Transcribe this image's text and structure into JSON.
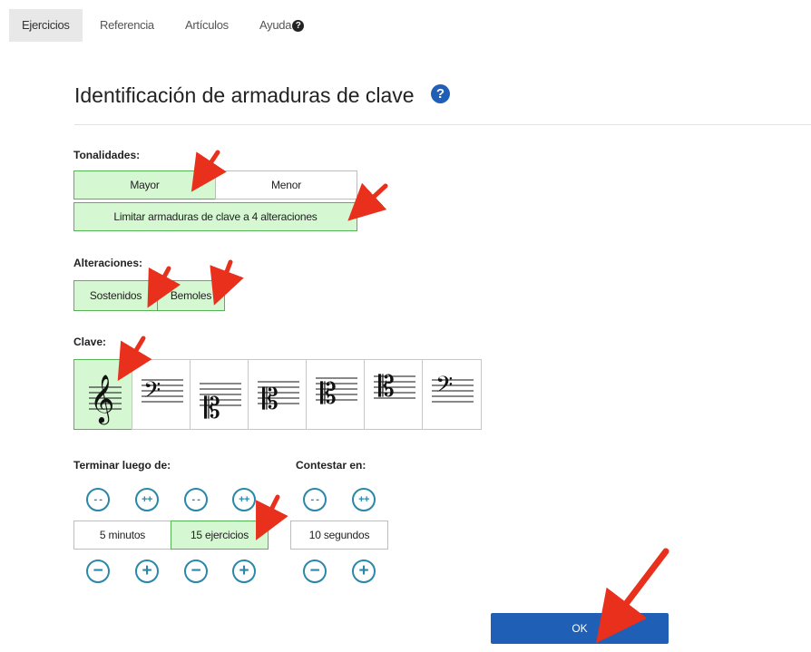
{
  "nav": {
    "tabs": [
      {
        "label": "Ejercicios",
        "active": true
      },
      {
        "label": "Referencia",
        "active": false
      },
      {
        "label": "Artículos",
        "active": false
      },
      {
        "label": "Ayuda",
        "active": false
      }
    ],
    "help_icon": "question-circle-icon"
  },
  "page": {
    "title": "Identificación de armaduras de clave",
    "help_icon": "question-circle-icon"
  },
  "tonalidades": {
    "label": "Tonalidades:",
    "mayor": "Mayor",
    "menor": "Menor",
    "limitar": "Limitar armaduras de clave a 4 alteraciones",
    "selected": [
      "Mayor",
      "Limitar armaduras de clave a 4 alteraciones"
    ]
  },
  "alteraciones": {
    "label": "Alteraciones:",
    "sostenidos": "Sostenidos",
    "bemoles": "Bemoles",
    "selected": [
      "Sostenidos",
      "Bemoles"
    ]
  },
  "clave": {
    "label": "Clave:",
    "options": [
      "treble-clef-icon",
      "bass-clef-icon",
      "alto-clef-low-icon",
      "alto-clef-icon",
      "tenor-clef-icon",
      "alto-clef-high-icon",
      "baritone-clef-icon"
    ],
    "selected": "treble-clef-icon"
  },
  "terminar": {
    "label": "Terminar luego de:",
    "minutos": "5 minutos",
    "ejercicios": "15 ejercicios",
    "selected": "15 ejercicios"
  },
  "contestar": {
    "label": "Contestar en:",
    "segundos": "10 segundos"
  },
  "steppers": {
    "double_minus": "- -",
    "double_plus": "++",
    "minus": "−",
    "plus": "+"
  },
  "ok_label": "OK",
  "colors": {
    "selected_bg": "#d5f7d2",
    "selected_border": "#55b455",
    "primary": "#1f5fb5",
    "stepper": "#2a87a8",
    "annotation_arrow": "#e8301c"
  }
}
